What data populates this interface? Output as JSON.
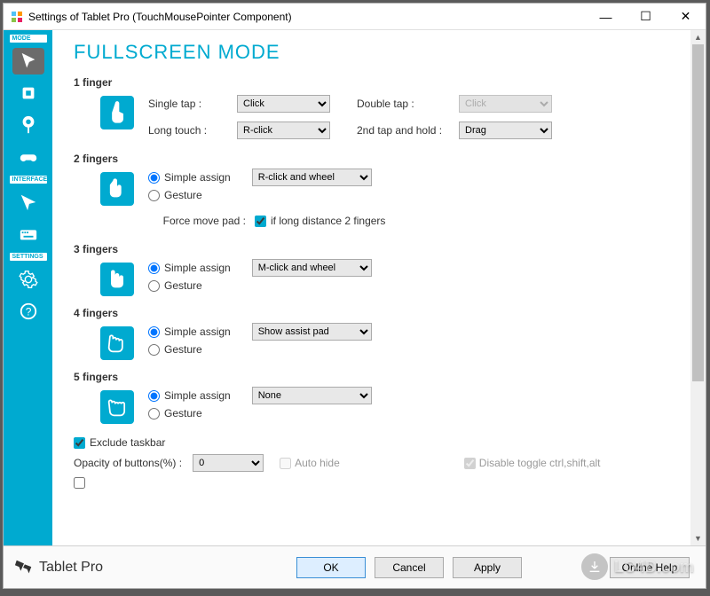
{
  "window": {
    "title": "Settings of Tablet Pro (TouchMousePointer Component)"
  },
  "sidebar": {
    "section_mode": "MODE",
    "section_interface": "INTERFACE",
    "section_settings": "SETTINGS"
  },
  "page": {
    "title": "FULLSCREEN MODE"
  },
  "f1": {
    "header": "1 finger",
    "single_tap_label": "Single tap :",
    "single_tap_value": "Click",
    "double_tap_label": "Double tap :",
    "double_tap_value": "Click",
    "long_touch_label": "Long touch :",
    "long_touch_value": "R-click",
    "second_tap_hold_label": "2nd tap and hold :",
    "second_tap_hold_value": "Drag"
  },
  "f2": {
    "header": "2 fingers",
    "simple_assign": "Simple assign",
    "gesture": "Gesture",
    "combo_value": "R-click and wheel",
    "force_label": "Force move pad :",
    "force_check_label": "if long distance 2 fingers"
  },
  "f3": {
    "header": "3 fingers",
    "simple_assign": "Simple assign",
    "gesture": "Gesture",
    "combo_value": "M-click and wheel"
  },
  "f4": {
    "header": "4 fingers",
    "simple_assign": "Simple assign",
    "gesture": "Gesture",
    "combo_value": "Show assist pad"
  },
  "f5": {
    "header": "5 fingers",
    "simple_assign": "Simple assign",
    "gesture": "Gesture",
    "combo_value": "None"
  },
  "bottom": {
    "exclude_taskbar": "Exclude taskbar",
    "opacity_label": "Opacity of buttons(%) :",
    "opacity_value": "0",
    "auto_hide": "Auto hide",
    "disable_toggle": "Disable toggle ctrl,shift,alt"
  },
  "footer": {
    "brand": "Tablet Pro",
    "ok": "OK",
    "cancel": "Cancel",
    "apply": "Apply",
    "help": "Online Help"
  },
  "watermark": "LO4D.com"
}
